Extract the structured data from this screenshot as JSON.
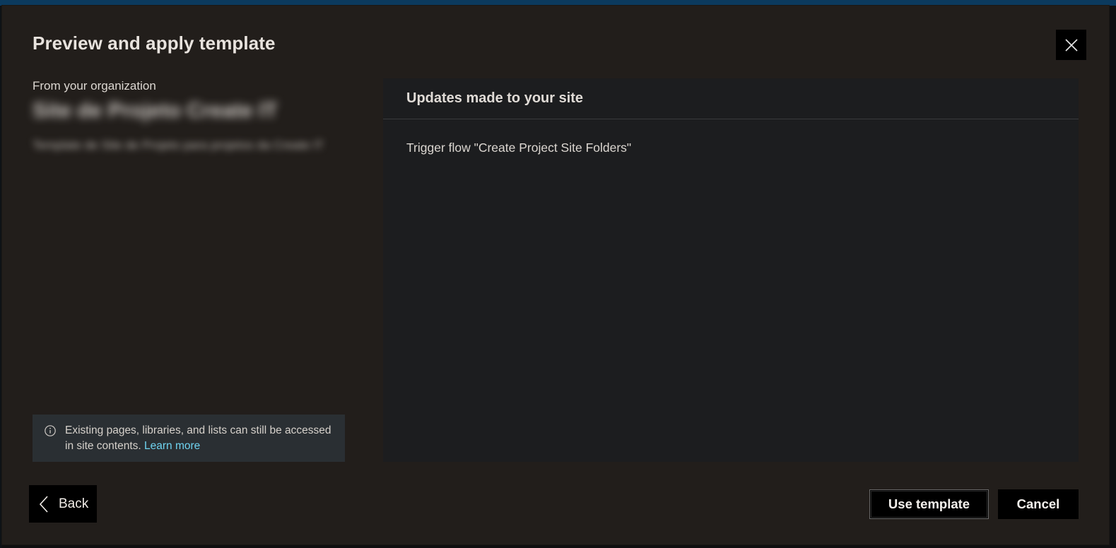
{
  "dialog": {
    "title": "Preview and apply template",
    "close_icon": "close-icon"
  },
  "left_panel": {
    "org_label": "From your organization",
    "template_name": "Site de Projeto Create IT",
    "template_description": "Template de Site de Projeto para projetos da Create IT",
    "info": {
      "icon": "info-icon",
      "text": "Existing pages, libraries, and lists can still be accessed in site contents.",
      "link_label": "Learn more"
    }
  },
  "right_panel": {
    "header": "Updates made to your site",
    "items": [
      "Trigger flow \"Create Project Site Folders\""
    ]
  },
  "footer": {
    "back_label": "Back",
    "back_icon": "chevron-left-icon",
    "use_template_label": "Use template",
    "cancel_label": "Cancel"
  },
  "colors": {
    "dialog_bg": "#221e1b",
    "panel_bg": "#1c1d1f",
    "info_bg": "#2a2f33",
    "link": "#6fd3f0",
    "button_bg": "#000000"
  }
}
